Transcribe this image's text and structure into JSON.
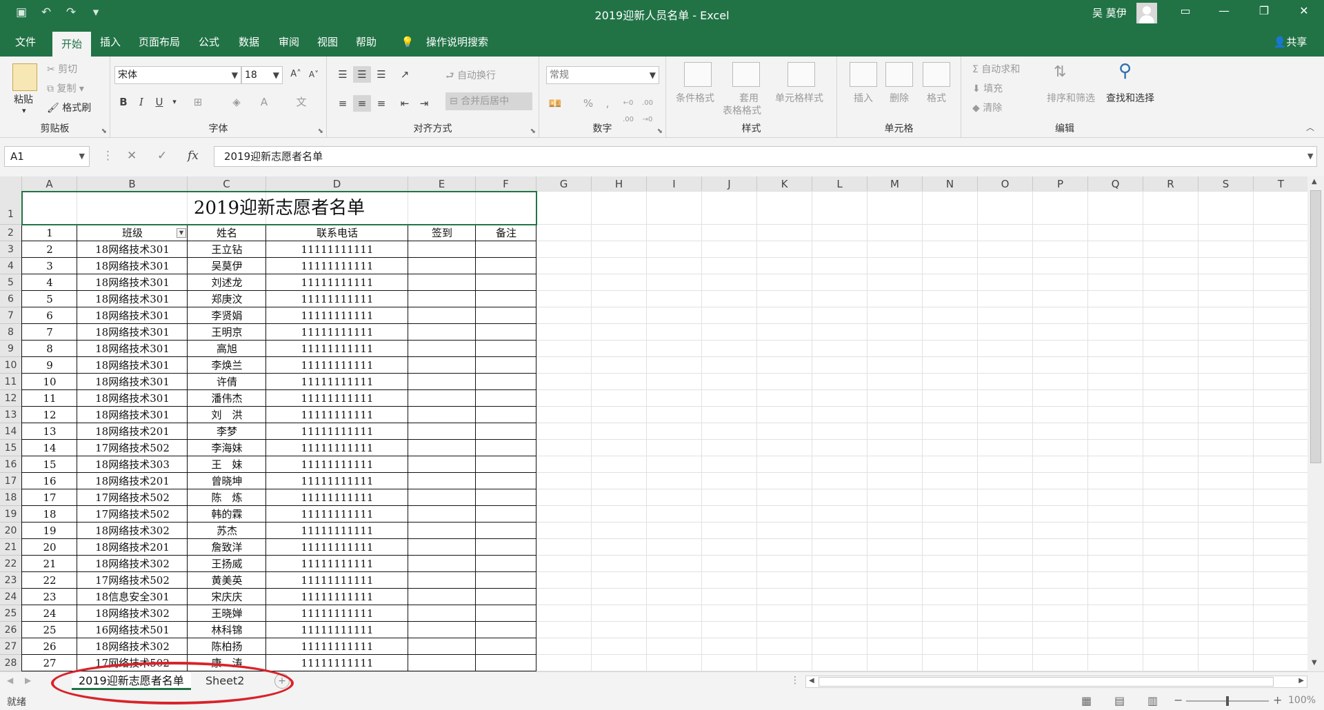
{
  "window": {
    "title": "2019迎新人员名单 - Excel",
    "user": "吴 莫伊",
    "share": "共享"
  },
  "qat": {
    "save_icon": "save-icon",
    "undo_icon": "undo-icon",
    "redo_icon": "redo-icon",
    "customize_icon": "customize-icon"
  },
  "tabs": [
    "文件",
    "开始",
    "插入",
    "页面布局",
    "公式",
    "数据",
    "审阅",
    "视图",
    "帮助",
    "操作说明搜索"
  ],
  "active_tab": "开始",
  "ribbon": {
    "clipboard": {
      "paste": "粘贴",
      "cut": "剪切",
      "copy": "复制",
      "format_painter": "格式刷",
      "label": "剪贴板"
    },
    "font": {
      "name": "宋体",
      "size": "18",
      "label": "字体",
      "bold": "B",
      "italic": "I",
      "underline": "U",
      "grow": "A",
      "shrink": "A",
      "font_color": "A",
      "phonetic": "文"
    },
    "alignment": {
      "wrap": "自动换行",
      "merge": "合并后居中",
      "label": "对齐方式"
    },
    "number": {
      "format": "常规",
      "percent": "%",
      "comma": ",",
      "inc_dec": "←0 .00",
      "dec_dec": ".00 →0",
      "label": "数字"
    },
    "styles": {
      "conditional": "条件格式",
      "table_format_1": "套用",
      "table_format_2": "表格格式",
      "cell_styles": "单元格样式",
      "label": "样式"
    },
    "cells": {
      "insert": "插入",
      "delete": "删除",
      "format": "格式",
      "label": "单元格"
    },
    "editing": {
      "autosum": "自动求和",
      "fill": "填充",
      "clear": "清除",
      "sort": "排序和筛选",
      "find": "查找和选择",
      "label": "编辑"
    }
  },
  "formula_bar": {
    "name_box": "A1",
    "fx": "fx",
    "cancel": "✕",
    "enter": "✓",
    "content": "2019迎新志愿者名单"
  },
  "columns": [
    "A",
    "B",
    "C",
    "D",
    "E",
    "F",
    "G",
    "H",
    "I",
    "J",
    "K",
    "L",
    "M",
    "N",
    "O",
    "P",
    "Q",
    "R",
    "S",
    "T"
  ],
  "sheet": {
    "title": "2019迎新志愿者名单",
    "header": [
      "1",
      "班级",
      "姓名",
      "联系电话",
      "签到",
      "备注"
    ],
    "rows": [
      [
        "2",
        "18网络技术301",
        "王立钻",
        "11111111111"
      ],
      [
        "3",
        "18网络技术301",
        "吴莫伊",
        "11111111111"
      ],
      [
        "4",
        "18网络技术301",
        "刘述龙",
        "11111111111"
      ],
      [
        "5",
        "18网络技术301",
        "郑庚汶",
        "11111111111"
      ],
      [
        "6",
        "18网络技术301",
        "李贤娟",
        "11111111111"
      ],
      [
        "7",
        "18网络技术301",
        "王明京",
        "11111111111"
      ],
      [
        "8",
        "18网络技术301",
        "高旭",
        "11111111111"
      ],
      [
        "9",
        "18网络技术301",
        "李焕兰",
        "11111111111"
      ],
      [
        "10",
        "18网络技术301",
        "许倩",
        "11111111111"
      ],
      [
        "11",
        "18网络技术301",
        "潘伟杰",
        "11111111111"
      ],
      [
        "12",
        "18网络技术301",
        "刘　洪",
        "11111111111"
      ],
      [
        "13",
        "18网络技术201",
        "李梦",
        "11111111111"
      ],
      [
        "14",
        "17网络技术502",
        "李海妹",
        "11111111111"
      ],
      [
        "15",
        "18网络技术303",
        "王　妹",
        "11111111111"
      ],
      [
        "16",
        "18网络技术201",
        "曾晓坤",
        "11111111111"
      ],
      [
        "17",
        "17网络技术502",
        "陈　炼",
        "11111111111"
      ],
      [
        "18",
        "17网络技术502",
        "韩的霖",
        "11111111111"
      ],
      [
        "19",
        "18网络技术302",
        "苏杰",
        "11111111111"
      ],
      [
        "20",
        "18网络技术201",
        "詹致洋",
        "11111111111"
      ],
      [
        "21",
        "18网络技术302",
        "王扬威",
        "11111111111"
      ],
      [
        "22",
        "17网络技术502",
        "黄美英",
        "11111111111"
      ],
      [
        "23",
        "18信息安全301",
        "宋庆庆",
        "11111111111"
      ],
      [
        "24",
        "18网络技术302",
        "王晓婵",
        "11111111111"
      ],
      [
        "25",
        "16网络技术501",
        "林科锦",
        "11111111111"
      ],
      [
        "26",
        "18网络技术302",
        "陈柏扬",
        "11111111111"
      ],
      [
        "27",
        "17网络技术502",
        "康　涛",
        "11111111111"
      ]
    ]
  },
  "sheet_tabs": [
    "2019迎新志愿者名单",
    "Sheet2"
  ],
  "add_sheet": "+",
  "status": {
    "ready": "就绪",
    "zoom": "100%"
  }
}
